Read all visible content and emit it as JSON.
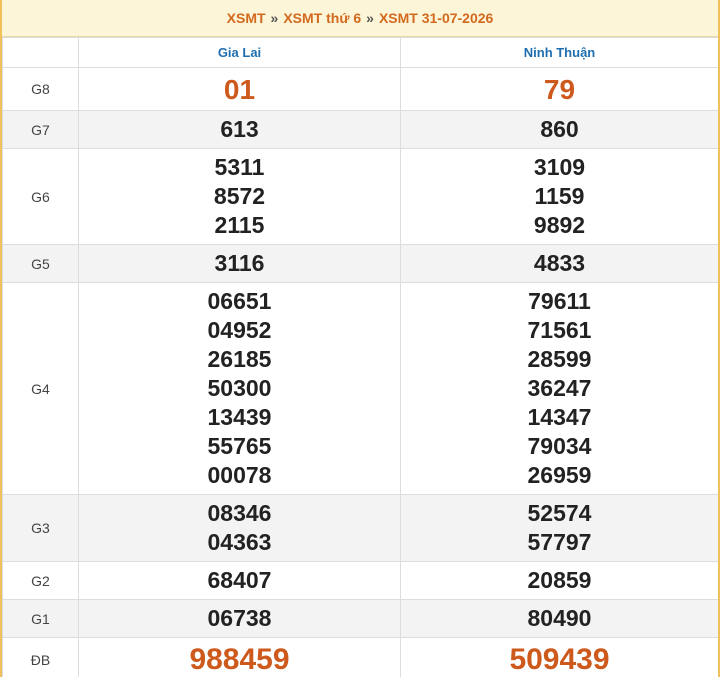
{
  "breadcrumb": {
    "items": [
      "XSMT",
      "XSMT thứ 6",
      "XSMT 31-07-2026"
    ],
    "separator": "»"
  },
  "table": {
    "provinces": [
      "Gia Lai",
      "Ninh Thuận"
    ],
    "rows": [
      {
        "label": "G8",
        "values": [
          [
            "01"
          ],
          [
            "79"
          ]
        ]
      },
      {
        "label": "G7",
        "values": [
          [
            "613"
          ],
          [
            "860"
          ]
        ]
      },
      {
        "label": "G6",
        "values": [
          [
            "5311",
            "8572",
            "2115"
          ],
          [
            "3109",
            "1159",
            "9892"
          ]
        ]
      },
      {
        "label": "G5",
        "values": [
          [
            "3116"
          ],
          [
            "4833"
          ]
        ]
      },
      {
        "label": "G4",
        "values": [
          [
            "06651",
            "04952",
            "26185",
            "50300",
            "13439",
            "55765",
            "00078"
          ],
          [
            "79611",
            "71561",
            "28599",
            "36247",
            "14347",
            "79034",
            "26959"
          ]
        ]
      },
      {
        "label": "G3",
        "values": [
          [
            "08346",
            "04363"
          ],
          [
            "52574",
            "57797"
          ]
        ]
      },
      {
        "label": "G2",
        "values": [
          [
            "68407"
          ],
          [
            "20859"
          ]
        ]
      },
      {
        "label": "G1",
        "values": [
          [
            "06738"
          ],
          [
            "80490"
          ]
        ]
      },
      {
        "label": "ĐB",
        "values": [
          [
            "988459"
          ],
          [
            "509439"
          ]
        ]
      }
    ]
  },
  "colors": {
    "accent": "#cd5a1c",
    "province_header": "#1f6fb0",
    "border": "#f0c05a",
    "title_bg": "#fdf5d8",
    "alt_row": "#f3f3f3"
  }
}
